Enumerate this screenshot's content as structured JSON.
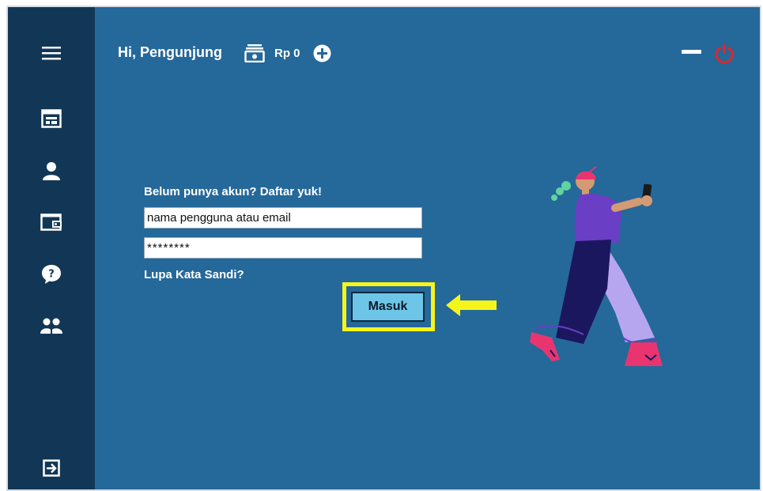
{
  "header": {
    "greeting": "Hi, Pengunjung",
    "balance": "Rp 0"
  },
  "login": {
    "register_prompt": "Belum punya akun? Daftar yuk!",
    "username_value": "nama pengguna atau email",
    "password_value": "********",
    "forgot_password": "Lupa Kata Sandi?",
    "submit_label": "Masuk"
  },
  "sidebar": {
    "items": [
      {
        "icon": "menu-icon"
      },
      {
        "icon": "browser-icon"
      },
      {
        "icon": "user-icon"
      },
      {
        "icon": "wallet-icon"
      },
      {
        "icon": "help-icon"
      },
      {
        "icon": "group-icon"
      },
      {
        "icon": "login-icon"
      }
    ]
  },
  "colors": {
    "background": "#25689a",
    "sidebar": "#123756",
    "highlight": "#f5f51b",
    "button": "#6dc6e8",
    "power": "#e0262a"
  }
}
